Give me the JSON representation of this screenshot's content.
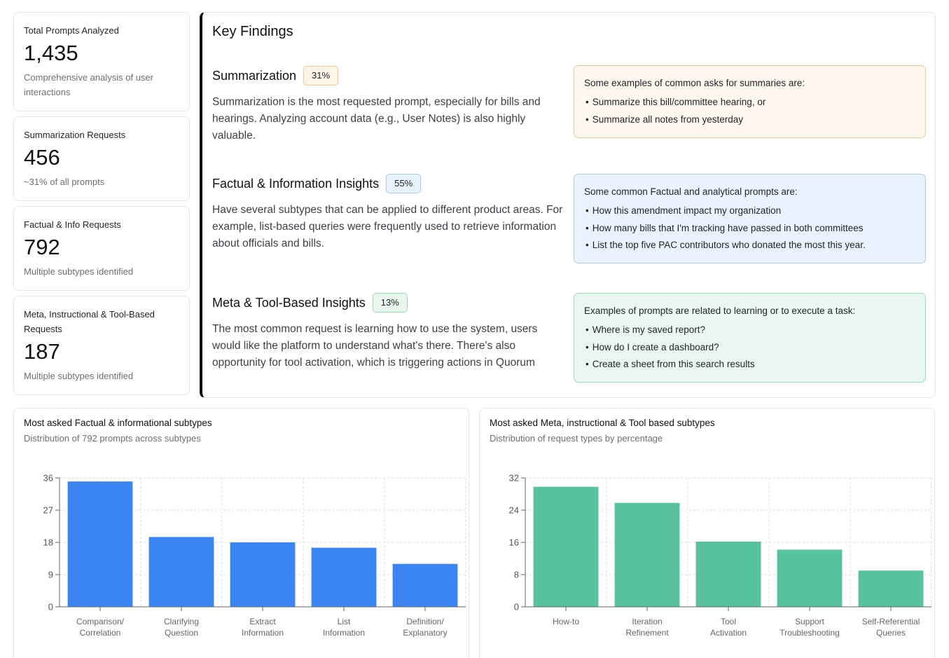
{
  "stats": [
    {
      "title": "Total Prompts Analyzed",
      "value": "1,435",
      "desc": "Comprehensive analysis of user interactions"
    },
    {
      "title": "Summarization Requests",
      "value": "456",
      "desc": "~31% of all prompts"
    },
    {
      "title": "Factual & Info Requests",
      "value": "792",
      "desc": "Multiple subtypes identified"
    },
    {
      "title": "Meta, Instructional & Tool-Based Requests",
      "value": "187",
      "desc": "Multiple subtypes identified"
    }
  ],
  "findings": {
    "title": "Key Findings",
    "items": [
      {
        "name": "Summarization",
        "pct": "31%",
        "text": "Summarization is the most requested prompt, especially for bills and hearings. Analyzing account data (e.g., User Notes) is also highly valuable.",
        "examples_intro": "Some examples of common asks for summaries are:",
        "examples": [
          "Summarize this bill/committee hearing, or",
          "Summarize all notes from yesterday"
        ]
      },
      {
        "name": "Factual & Information Insights",
        "pct": "55%",
        "text": "Have several subtypes that can be applied to different product areas. For example, list-based queries were frequently used to retrieve information about officials and bills.",
        "examples_intro": "Some common Factual and analytical prompts are:",
        "examples": [
          "How this amendment impact my organization",
          "How many bills that I'm tracking have passed in both committees",
          "List the top five PAC contributors who donated the most this year."
        ]
      },
      {
        "name": "Meta & Tool-Based Insights",
        "pct": "13%",
        "text": "The most common request is learning how to use the system, users would like the platform to understand what's there. There's also opportunity for tool activation, which is triggering actions in Quorum",
        "examples_intro": "Examples of prompts are related to learning or to execute a task:",
        "examples": [
          "Where is my saved report?",
          "How do I create a dashboard?",
          "Create a sheet from this search results"
        ]
      }
    ]
  },
  "chart_data": [
    {
      "type": "bar",
      "title": "Most asked Factual & informational subtypes",
      "subtitle": "Distribution of 792 prompts across subtypes",
      "categories": [
        [
          "Comparison/",
          "Correlation"
        ],
        [
          "Clarifying",
          "Question"
        ],
        [
          "Extract",
          "Information"
        ],
        [
          "List",
          "Information"
        ],
        [
          "Definition/",
          "Explanatory"
        ]
      ],
      "values": [
        35,
        19.5,
        18,
        16.5,
        12
      ],
      "yticks": [
        0,
        9,
        18,
        27,
        36
      ],
      "ylim": [
        0,
        36
      ],
      "color": "#3b86f3",
      "grid": true
    },
    {
      "type": "bar",
      "title": "Most asked Meta, instructional & Tool based subtypes",
      "subtitle": "Distribution of request types by percentage",
      "categories": [
        [
          "How-to"
        ],
        [
          "Iteration",
          "Refinement"
        ],
        [
          "Tool",
          "Activation"
        ],
        [
          "Support",
          "Troubleshooting"
        ],
        [
          "Self-Referential",
          "Queries"
        ]
      ],
      "values": [
        29.8,
        25.8,
        16.2,
        14.2,
        9
      ],
      "yticks": [
        0,
        8,
        16,
        24,
        32
      ],
      "ylim": [
        0,
        32
      ],
      "color": "#58c29e",
      "grid": true
    }
  ]
}
